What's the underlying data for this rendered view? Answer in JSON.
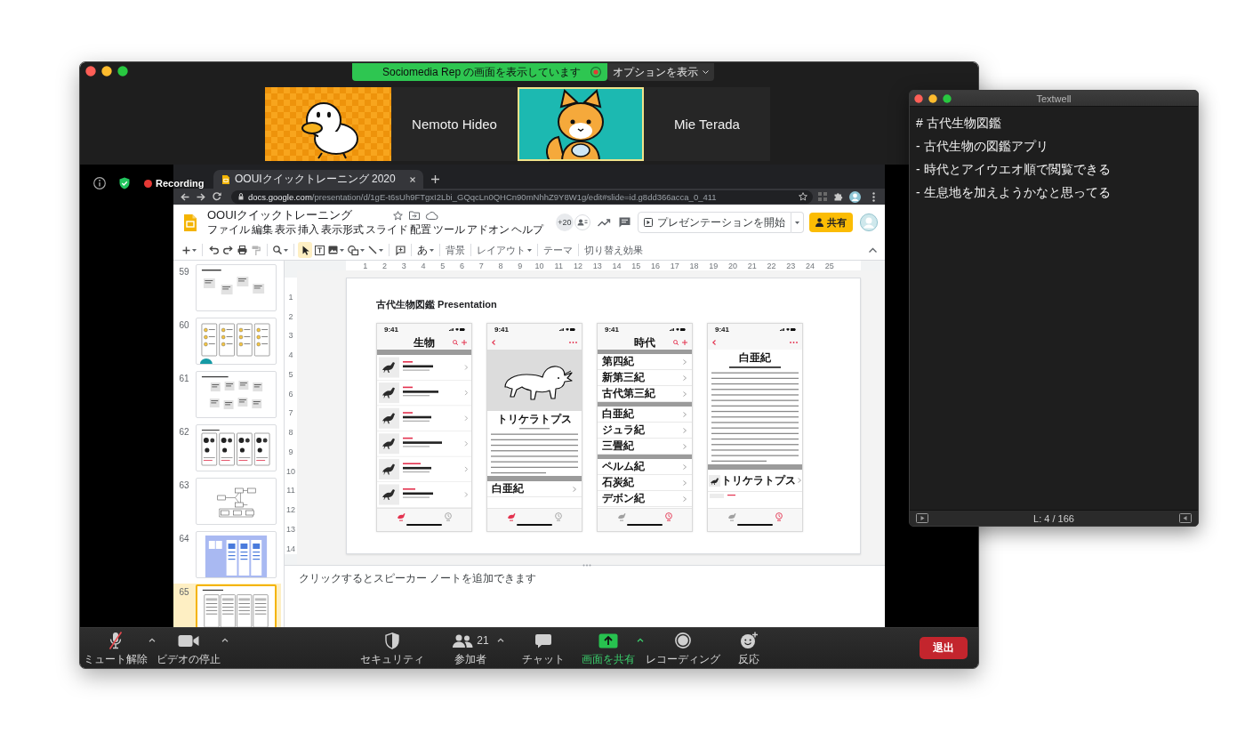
{
  "zoom": {
    "share_banner": "Sociomedia Rep の画面を表示しています",
    "view_options": "オプションを表示",
    "participants": [
      {
        "name": "Nemoto Hideo",
        "kind": "duck",
        "speaking": false
      },
      {
        "name": "Mie Terada",
        "kind": "fox",
        "speaking": true
      }
    ],
    "recording": "Recording",
    "toolbar": [
      {
        "kind": "mic",
        "label": "ミュート解除",
        "muted": true,
        "active": false,
        "menu": true
      },
      {
        "kind": "video",
        "label": "ビデオの停止",
        "active": false,
        "menu": true
      },
      {
        "kind": "security",
        "label": "セキュリティ",
        "active": false,
        "menu": false
      },
      {
        "kind": "participants",
        "label": "参加者",
        "count": "21",
        "active": false,
        "menu": true
      },
      {
        "kind": "chat",
        "label": "チャット",
        "active": false,
        "menu": false
      },
      {
        "kind": "share",
        "label": "画面を共有",
        "active": true,
        "menu": true
      },
      {
        "kind": "record",
        "label": "レコーディング",
        "active": false,
        "menu": false
      },
      {
        "kind": "reactions",
        "label": "反応",
        "active": false,
        "menu": false
      }
    ],
    "leave_button": "退出"
  },
  "browser": {
    "tab_title": "OOUIクイックトレーニング 2020",
    "url_host": "docs.google.com",
    "url_path": "/presentation/d/1gE-t6sUh9FTgxI2Lbi_GQqcLn0QHCn90mNhhZ9Y8W1g/edit#slide=id.g8dd366acca_0_411"
  },
  "slides": {
    "doc_title": "OOUIクイックトレーニング",
    "menu_bar": [
      "ファイル",
      "編集",
      "表示",
      "挿入",
      "表示形式",
      "スライド",
      "配置",
      "ツール",
      "アドオン",
      "ヘルプ"
    ],
    "collaborators": "+20",
    "present_button": "プレゼンテーションを開始",
    "share_button": "共有",
    "toolbar": [
      [
        {
          "kind": "add",
          "selected": false,
          "dropdown": true
        }
      ],
      [
        {
          "kind": "undo",
          "selected": false,
          "dropdown": false
        },
        {
          "kind": "redo",
          "selected": false,
          "dropdown": false
        },
        {
          "kind": "print",
          "selected": false,
          "dropdown": false
        },
        {
          "kind": "paint_format",
          "selected": false,
          "dropdown": false
        }
      ],
      [
        {
          "kind": "zoom",
          "selected": false,
          "dropdown": true
        }
      ],
      [
        {
          "kind": "select",
          "selected": true,
          "dropdown": false
        },
        {
          "kind": "text_box",
          "selected": false,
          "dropdown": false
        },
        {
          "kind": "image",
          "selected": false,
          "dropdown": true
        },
        {
          "kind": "shape",
          "selected": false,
          "dropdown": true
        },
        {
          "kind": "line",
          "selected": false,
          "dropdown": true
        }
      ],
      [
        {
          "kind": "comment",
          "selected": false,
          "dropdown": false
        }
      ],
      [
        {
          "kind": "input_tools",
          "label": "あ",
          "selected": false,
          "dropdown": true
        }
      ],
      [
        {
          "kind": "text",
          "label": "背景",
          "selected": false,
          "dropdown": false
        }
      ],
      [
        {
          "kind": "text",
          "label": "レイアウト",
          "selected": false,
          "dropdown": true
        }
      ],
      [
        {
          "kind": "text",
          "label": "テーマ",
          "selected": false,
          "dropdown": false
        }
      ],
      [
        {
          "kind": "text",
          "label": "切り替え効果",
          "selected": false,
          "dropdown": false
        }
      ]
    ],
    "ruler": {
      "horizontal": [
        "1",
        "2",
        "3",
        "4",
        "5",
        "6",
        "7",
        "8",
        "9",
        "10",
        "11",
        "12",
        "13",
        "14",
        "15",
        "16",
        "17",
        "18",
        "19",
        "20",
        "21",
        "22",
        "23",
        "24",
        "25"
      ],
      "vertical": [
        "1",
        "2",
        "3",
        "4",
        "5",
        "6",
        "7",
        "8",
        "9",
        "10",
        "11",
        "12",
        "13",
        "14"
      ]
    },
    "filmstrip": [
      {
        "number": "59",
        "kind": "cards",
        "selected": false
      },
      {
        "number": "60",
        "kind": "sketches",
        "selected": false
      },
      {
        "number": "61",
        "kind": "card_grid",
        "selected": false
      },
      {
        "number": "62",
        "kind": "screens",
        "selected": false
      },
      {
        "number": "63",
        "kind": "flow",
        "selected": false
      },
      {
        "number": "64",
        "kind": "board",
        "selected": false
      },
      {
        "number": "65",
        "kind": "phones",
        "selected": true
      }
    ],
    "slide": {
      "title": "古代生物図鑑 Presentation",
      "phones": [
        {
          "kind": "list",
          "time": "9:41",
          "title": "生物",
          "tabs": [
            {
              "kind": "creatures",
              "selected": true
            },
            {
              "kind": "eras",
              "selected": false
            }
          ]
        },
        {
          "kind": "detail",
          "time": "9:41",
          "name": "トリケラトプス",
          "era": "白亜紀",
          "tabs": [
            {
              "kind": "creatures",
              "selected": true
            },
            {
              "kind": "eras",
              "selected": false
            }
          ]
        },
        {
          "kind": "sectioned_list",
          "time": "9:41",
          "title": "時代",
          "sections": [
            {
              "rows": [
                "第四紀",
                "新第三紀",
                "古代第三紀"
              ]
            },
            {
              "rows": [
                "白亜紀",
                "ジュラ紀",
                "三畳紀"
              ]
            },
            {
              "rows": [
                "ペルム紀",
                "石炭紀",
                "デボン紀"
              ]
            }
          ],
          "tabs": [
            {
              "kind": "creatures",
              "selected": false
            },
            {
              "kind": "eras",
              "selected": true
            }
          ]
        },
        {
          "kind": "era_detail",
          "time": "9:41",
          "title": "白亜紀",
          "creatures": [
            {
              "name": "トリケラトプス"
            }
          ],
          "tabs": [
            {
              "kind": "creatures",
              "selected": false
            },
            {
              "kind": "eras",
              "selected": true
            }
          ]
        }
      ]
    },
    "speaker_notes": {
      "placeholder": "クリックするとスピーカー ノートを追加できます"
    }
  },
  "textwell": {
    "title": "Textwell",
    "lines": [
      "# 古代生物図鑑",
      "- 古代生物の図鑑アプリ",
      "- 時代とアイウエオ順で閲覧できる",
      "- 生息地を加えようかなと思ってる"
    ],
    "status": "L: 4 / 166"
  }
}
